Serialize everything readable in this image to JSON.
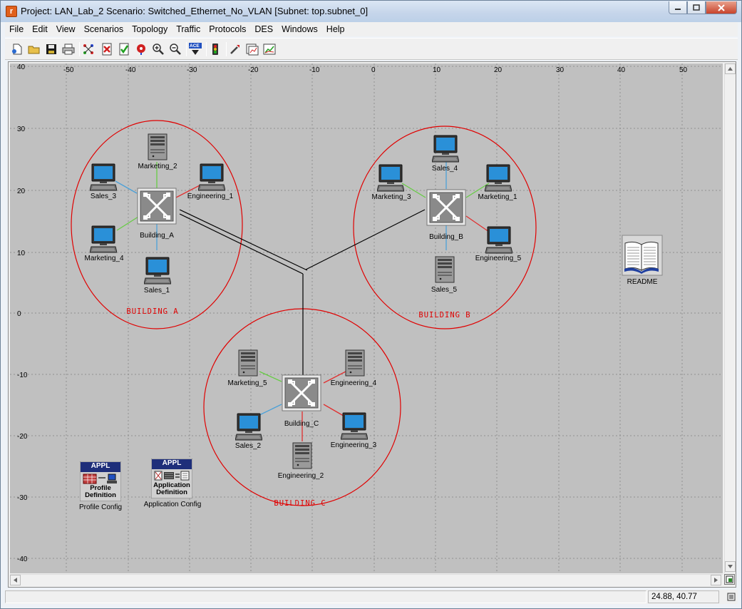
{
  "window": {
    "title": "Project: LAN_Lab_2 Scenario: Switched_Ethernet_No_VLAN  [Subnet: top.subnet_0]",
    "app_icon_glyph": "r",
    "controls": [
      "minimize-icon",
      "maximize-icon",
      "close-icon"
    ]
  },
  "menu": [
    "File",
    "Edit",
    "View",
    "Scenarios",
    "Topology",
    "Traffic",
    "Protocols",
    "DES",
    "Windows",
    "Help"
  ],
  "toolbar": {
    "buttons": [
      "new-icon",
      "open-icon",
      "save-icon",
      "print-icon",
      "node-palette-icon",
      "delete-icon",
      "verify-links-icon",
      "failure-icon",
      "zoom-in-icon",
      "zoom-out-icon",
      "ace-icon",
      "run-simulation-icon",
      "configure-simulation-icon",
      "view-results-icon",
      "results-browser-icon"
    ],
    "ace_label": "ACE"
  },
  "axes": {
    "x_ticks": [
      "-50",
      "-40",
      "-30",
      "-20",
      "-10",
      "0",
      "10",
      "20",
      "30",
      "40",
      "50"
    ],
    "y_ticks": [
      "40",
      "30",
      "20",
      "10",
      "0",
      "-10",
      "-20",
      "-30",
      "-40"
    ]
  },
  "buildings": {
    "a": "BUILDING A",
    "b": "BUILDING B",
    "c": "BUILDING C"
  },
  "switches": {
    "a": "Building_A",
    "b": "Building_B",
    "c": "Building_C"
  },
  "nodes": {
    "marketing_2": "Marketing_2",
    "sales_3": "Sales_3",
    "engineering_1": "Engineering_1",
    "marketing_4": "Marketing_4",
    "sales_1": "Sales_1",
    "sales_4": "Sales_4",
    "marketing_3": "Marketing_3",
    "marketing_1": "Marketing_1",
    "engineering_5": "Engineering_5",
    "sales_5": "Sales_5",
    "marketing_5": "Marketing_5",
    "engineering_4": "Engineering_4",
    "sales_2": "Sales_2",
    "engineering_3": "Engineering_3",
    "engineering_2": "Engineering_2"
  },
  "readme": "README",
  "profile_config": {
    "badge": "APPL",
    "line1": "Profile",
    "line2": "Definition",
    "label": "Profile Config"
  },
  "application_config": {
    "badge": "APPL",
    "line1": "Application",
    "line2": "Definition",
    "label": "Application Config"
  },
  "status": {
    "coordinates": "24.88, 40.77"
  },
  "colors": {
    "canvas": "#c0c0c0",
    "building_circle": "#e00000",
    "link_marketing": "#66cc44",
    "link_sales": "#4aa0d8",
    "link_engineering": "#e03030",
    "trunk": "#000000"
  }
}
